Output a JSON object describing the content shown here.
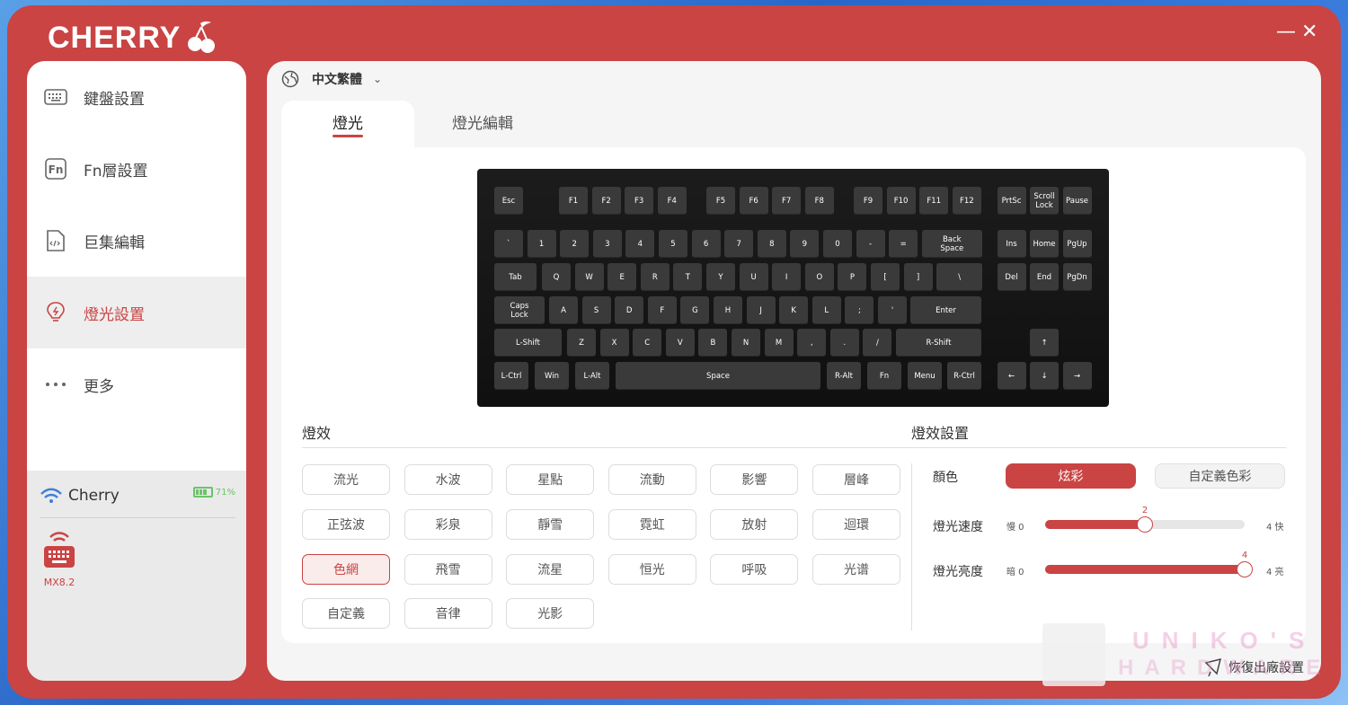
{
  "brand": {
    "logo_text": "CHERRY",
    "accent": "#c94443"
  },
  "window": {
    "minimize_glyph": "—",
    "close_glyph": "✕"
  },
  "sidebar": {
    "items": [
      {
        "label": "鍵盤設置",
        "icon": "keyboard-icon"
      },
      {
        "label": "Fn層設置",
        "icon": "fn-icon"
      },
      {
        "label": "巨集編輯",
        "icon": "macro-file-icon"
      },
      {
        "label": "燈光設置",
        "icon": "light-bulb-icon",
        "active": true
      },
      {
        "label": "更多",
        "icon": "more-icon"
      }
    ],
    "device": {
      "name": "Cherry",
      "battery": "71%",
      "battery_level": 0.71,
      "model": "MX8.2"
    }
  },
  "header": {
    "language": "中文繁體"
  },
  "tabs": [
    {
      "label": "燈光",
      "active": true
    },
    {
      "label": "燈光編輯",
      "active": false
    }
  ],
  "keyboard": {
    "keys": {
      "esc": "Esc",
      "f": [
        "F1",
        "F2",
        "F3",
        "F4",
        "F5",
        "F6",
        "F7",
        "F8",
        "F9",
        "F10",
        "F11",
        "F12"
      ],
      "nav_top": [
        "PrtSc",
        "Scroll Lock",
        "Pause"
      ],
      "num_row": [
        "`",
        "1",
        "2",
        "3",
        "4",
        "5",
        "6",
        "7",
        "8",
        "9",
        "0",
        "-",
        "="
      ],
      "backspace": "Back Space",
      "nav_mid1": [
        "Ins",
        "Home",
        "PgUp"
      ],
      "tab": "Tab",
      "q_row": [
        "Q",
        "W",
        "E",
        "R",
        "T",
        "Y",
        "U",
        "I",
        "O",
        "P",
        "[",
        "]",
        "\\"
      ],
      "nav_mid2": [
        "Del",
        "End",
        "PgDn"
      ],
      "caps": "Caps Lock",
      "a_row": [
        "A",
        "S",
        "D",
        "F",
        "G",
        "H",
        "J",
        "K",
        "L",
        ";",
        "'"
      ],
      "enter": "Enter",
      "lshift": "L-Shift",
      "z_row": [
        "Z",
        "X",
        "C",
        "V",
        "B",
        "N",
        "M",
        ",",
        ".",
        "/"
      ],
      "rshift": "R-Shift",
      "up": "↑",
      "bottom": [
        "L-Ctrl",
        "Win",
        "L-Alt",
        "Space",
        "R-Alt",
        "Fn",
        "Menu",
        "R-Ctrl"
      ],
      "arrows": [
        "←",
        "↓",
        "→"
      ]
    }
  },
  "effects": {
    "title": "燈效",
    "items": [
      "流光",
      "水波",
      "星點",
      "流動",
      "影響",
      "層峰",
      "正弦波",
      "彩泉",
      "靜雪",
      "霓虹",
      "放射",
      "迴環",
      "色網",
      "飛雪",
      "流星",
      "恒光",
      "呼吸",
      "光谱",
      "自定義",
      "音律",
      "光影"
    ],
    "active": "色網"
  },
  "settings": {
    "title": "燈效設置",
    "color_label": "顏色",
    "color_options": [
      "炫彩",
      "自定義色彩"
    ],
    "color_active": "炫彩",
    "speed": {
      "label": "燈光速度",
      "min_label": "慢 0",
      "max_label": "4 快",
      "value": 2,
      "value_text": "2",
      "max": 4
    },
    "brightness": {
      "label": "燈光亮度",
      "min_label": "暗 0",
      "max_label": "4 亮",
      "value": 4,
      "value_text": "4",
      "max": 4
    }
  },
  "footer": {
    "reset_label": "恢復出廠設置"
  },
  "watermark": {
    "line1": "UNIKO'S",
    "line2": "HARDWARE"
  }
}
